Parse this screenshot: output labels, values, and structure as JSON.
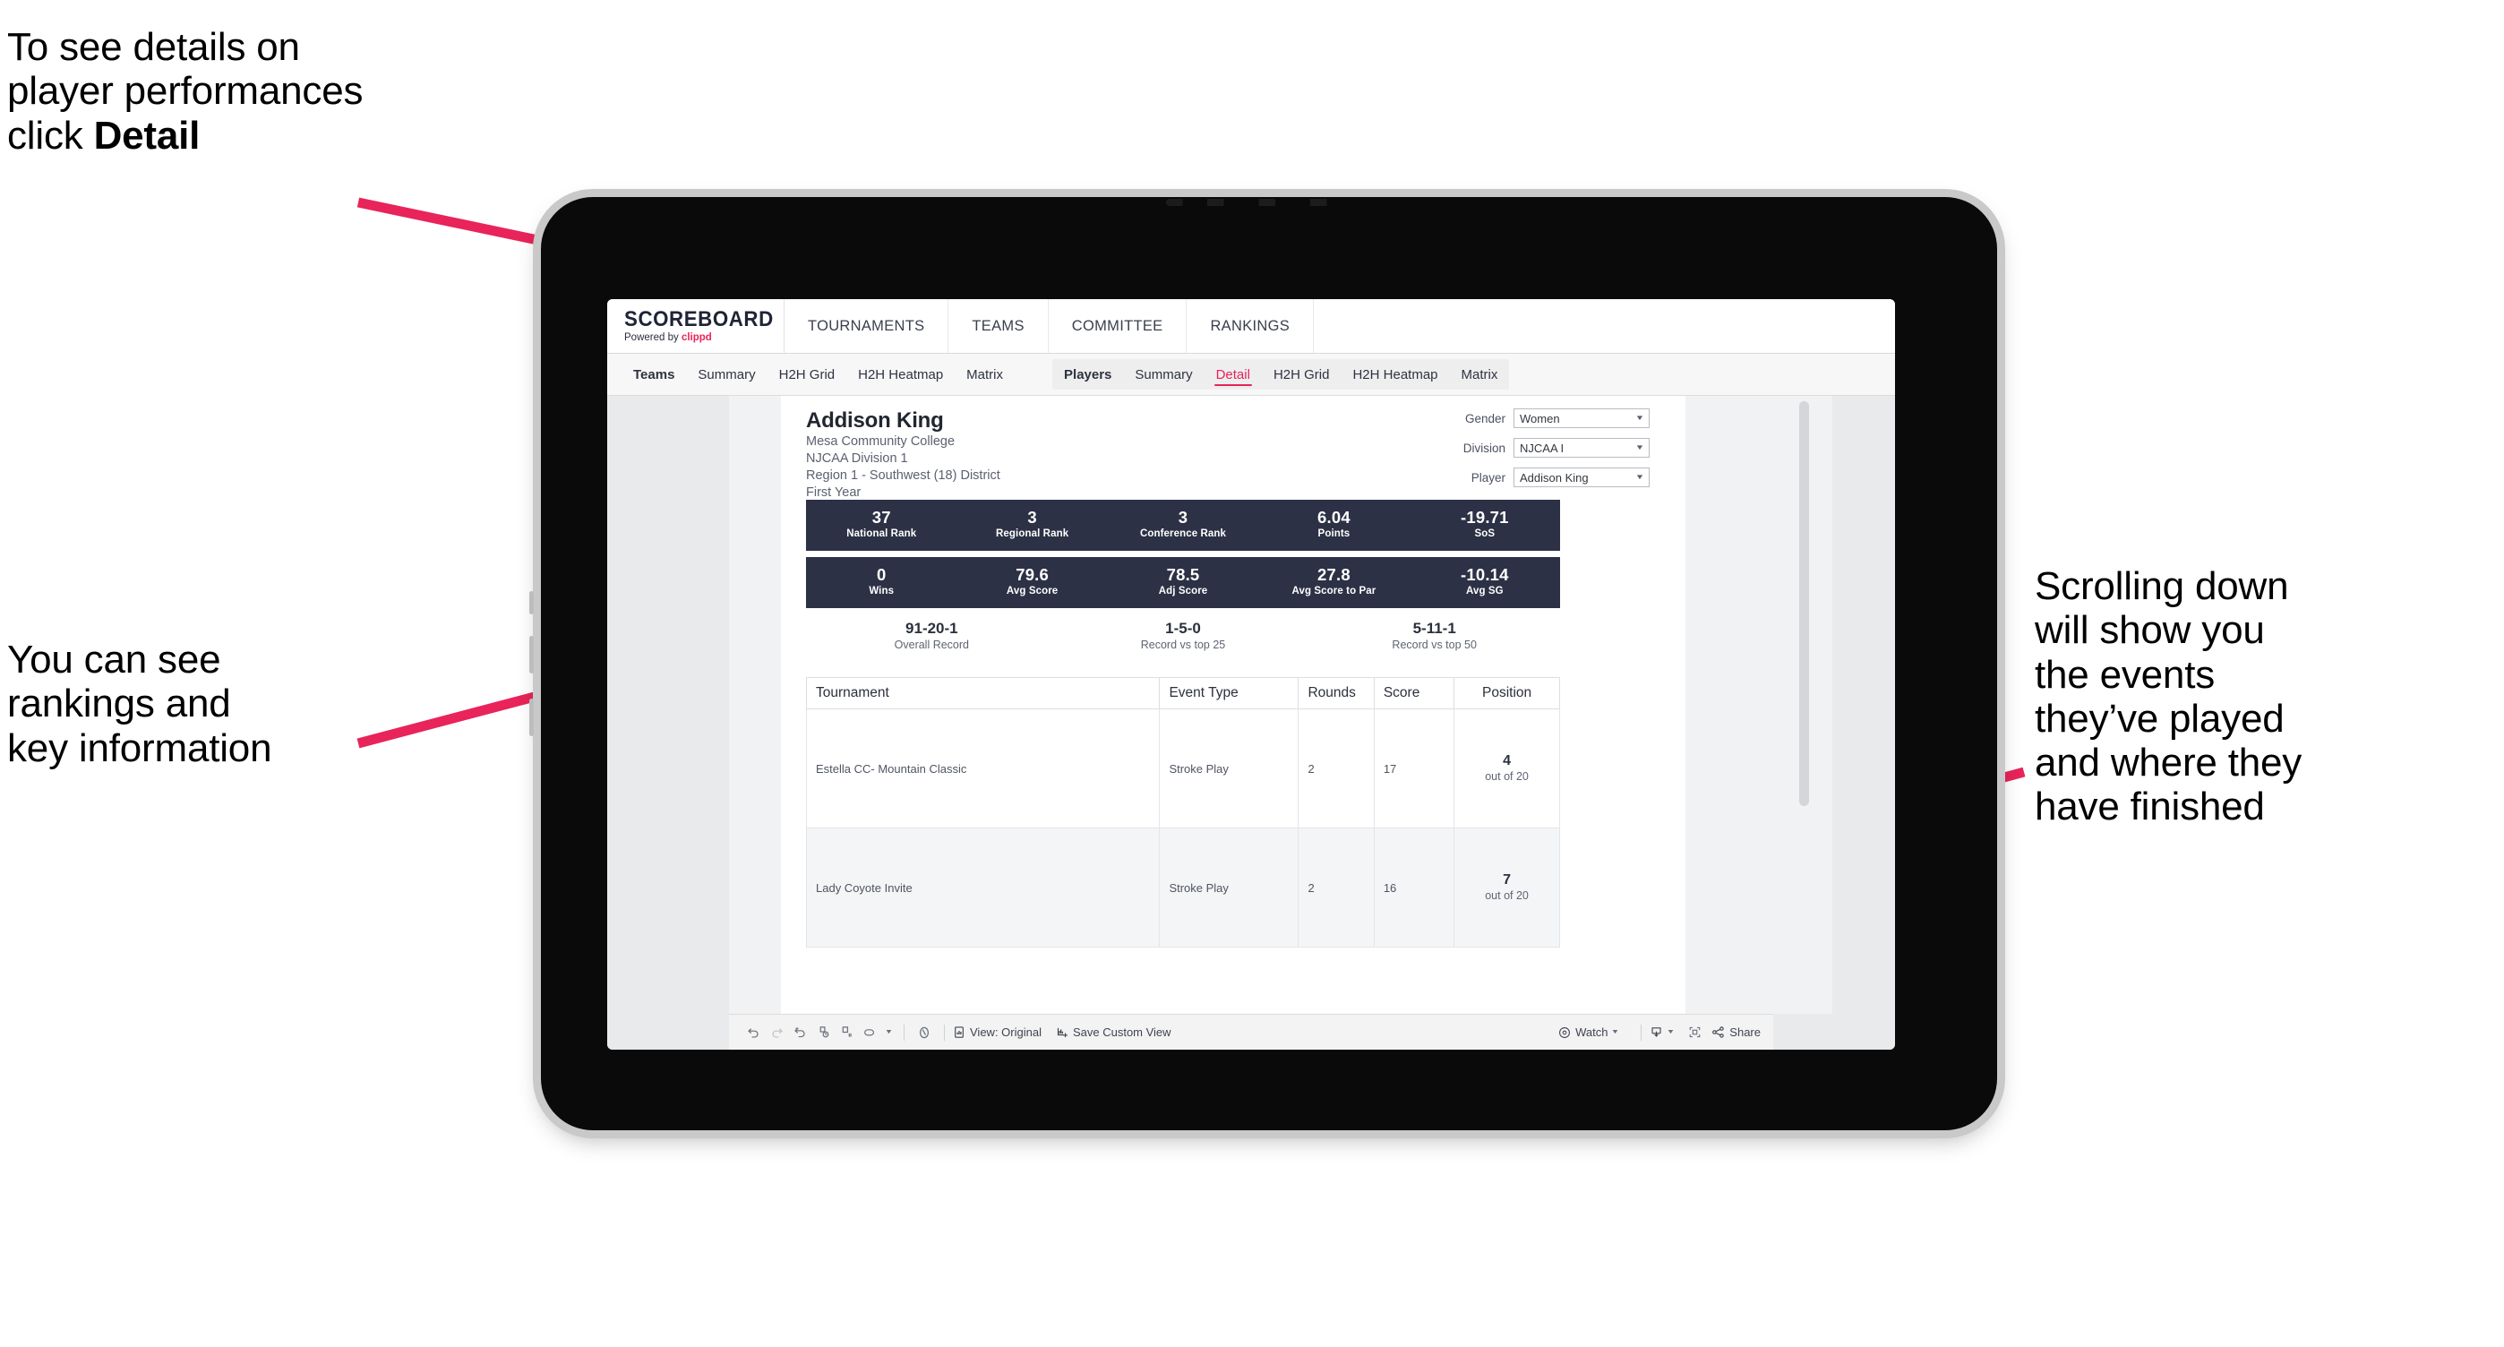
{
  "annotations": {
    "detail_hint": "To see details on\nplayer performances\nclick ",
    "detail_hint_bold": "Detail",
    "rankings_hint": "You can see\nrankings and\nkey information",
    "scroll_hint": "Scrolling down\nwill show you\nthe events\nthey’ve played\nand where they\nhave finished",
    "arrow_color": "#E8245A"
  },
  "app": {
    "brand": {
      "title": "SCOREBOARD",
      "powered_prefix": "Powered by ",
      "powered_name": "clippd"
    },
    "top_nav": [
      {
        "label": "TOURNAMENTS"
      },
      {
        "label": "TEAMS"
      },
      {
        "label": "COMMITTEE"
      },
      {
        "label": "RANKINGS"
      }
    ],
    "sub_nav": {
      "teams_group": [
        {
          "label": "Teams",
          "head": true,
          "active": false
        },
        {
          "label": "Summary",
          "head": false,
          "active": false
        },
        {
          "label": "H2H Grid",
          "head": false,
          "active": false
        },
        {
          "label": "H2H Heatmap",
          "head": false,
          "active": false
        },
        {
          "label": "Matrix",
          "head": false,
          "active": false
        }
      ],
      "players_group": [
        {
          "label": "Players",
          "head": true,
          "active": false
        },
        {
          "label": "Summary",
          "head": false,
          "active": false
        },
        {
          "label": "Detail",
          "head": false,
          "active": true
        },
        {
          "label": "H2H Grid",
          "head": false,
          "active": false
        },
        {
          "label": "H2H Heatmap",
          "head": false,
          "active": false
        },
        {
          "label": "Matrix",
          "head": false,
          "active": false
        }
      ]
    }
  },
  "player": {
    "name": "Addison King",
    "school": "Mesa Community College",
    "division": "NJCAA Division 1",
    "region": "Region 1 - Southwest (18) District",
    "class_year": "First Year"
  },
  "filters": [
    {
      "label": "Gender",
      "value": "Women"
    },
    {
      "label": "Division",
      "value": "NJCAA I"
    },
    {
      "label": "Player",
      "value": "Addison King"
    }
  ],
  "stat_bands": [
    {
      "cells": [
        {
          "value": "37",
          "label": "National Rank"
        },
        {
          "value": "3",
          "label": "Regional Rank"
        },
        {
          "value": "3",
          "label": "Conference Rank"
        },
        {
          "value": "6.04",
          "label": "Points"
        },
        {
          "value": "-19.71",
          "label": "SoS"
        }
      ]
    },
    {
      "cells": [
        {
          "value": "0",
          "label": "Wins"
        },
        {
          "value": "79.6",
          "label": "Avg Score"
        },
        {
          "value": "78.5",
          "label": "Adj Score"
        },
        {
          "value": "27.8",
          "label": "Avg Score to Par"
        },
        {
          "value": "-10.14",
          "label": "Avg SG"
        }
      ]
    }
  ],
  "records": [
    {
      "value": "91-20-1",
      "label": "Overall Record"
    },
    {
      "value": "1-5-0",
      "label": "Record vs top 25"
    },
    {
      "value": "5-11-1",
      "label": "Record vs top 50"
    }
  ],
  "table": {
    "columns": [
      "Tournament",
      "Event Type",
      "Rounds",
      "Score",
      "Position"
    ],
    "rows": [
      {
        "tournament": "Estella CC- Mountain Classic",
        "event_type": "Stroke Play",
        "rounds": "2",
        "score": "17",
        "position_rank": "4",
        "position_of": "out of 20"
      },
      {
        "tournament": "Lady Coyote Invite",
        "event_type": "Stroke Play",
        "rounds": "2",
        "score": "16",
        "position_rank": "7",
        "position_of": "out of 20"
      }
    ]
  },
  "toolbar": {
    "view_label": "View: Original",
    "save_label": "Save Custom View",
    "watch_label": "Watch",
    "share_label": "Share"
  },
  "colors": {
    "accent": "#E8245A",
    "band_bg": "#2C3145",
    "header_text": "#22262F"
  }
}
